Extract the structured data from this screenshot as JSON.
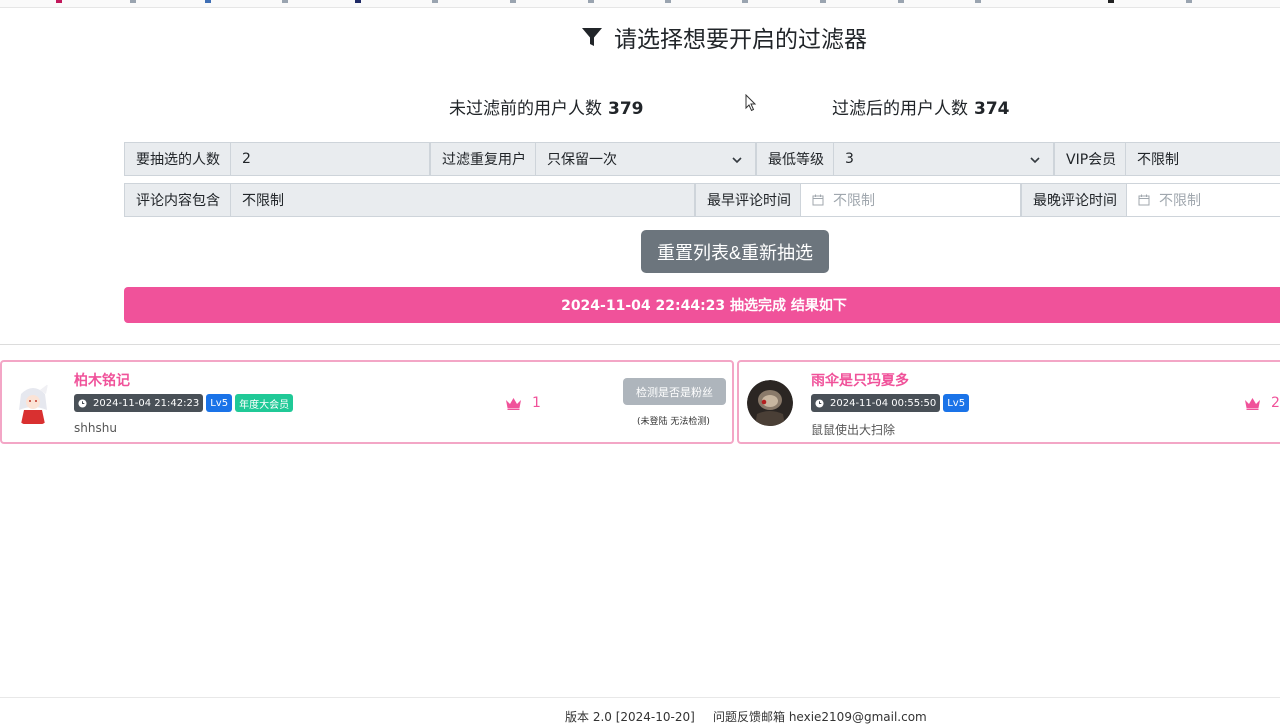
{
  "header": {
    "title": "请选择想要开启的过滤器",
    "before_label": "未过滤前的用户人数",
    "before_count": "379",
    "after_label": "过滤后的用户人数",
    "after_count": "374"
  },
  "filters": {
    "pick_count_label": "要抽选的人数",
    "pick_count_value": "2",
    "dedupe_label": "过滤重复用户",
    "dedupe_value": "只保留一次",
    "min_level_label": "最低等级",
    "min_level_value": "3",
    "vip_label": "VIP会员",
    "vip_value": "不限制",
    "comment_contains_label": "评论内容包含",
    "comment_contains_value": "不限制",
    "earliest_time_label": "最早评论时间",
    "earliest_time_placeholder": "不限制",
    "latest_time_label": "最晚评论时间",
    "latest_time_placeholder": "不限制"
  },
  "actions": {
    "reset_label": "重置列表&重新抽选"
  },
  "result_banner": "2024-11-04 22:44:23 抽选完成 结果如下",
  "winners": [
    {
      "name": "柏木铭记",
      "time": "2024-11-04 21:42:23",
      "level": "Lv5",
      "vip": "年度大会员",
      "comment": "shhshu",
      "rank": "1",
      "check_label": "检测是否是粉丝",
      "check_note": "(未登陆 无法检测)"
    },
    {
      "name": "雨伞是只玛夏多",
      "time": "2024-11-04 00:55:50",
      "level": "Lv5",
      "comment": "鼠鼠使出大扫除",
      "rank": "2"
    }
  ],
  "footer": {
    "version": "版本 2.0 [2024-10-20]",
    "feedback": "问题反馈邮箱 hexie2109@gmail.com"
  },
  "colors": {
    "accent": "#f0529a",
    "button_gray": "#6c757d",
    "level_badge": "#1a73e8",
    "vip_badge": "#20c997"
  },
  "icons": [
    "filter-icon",
    "chevron-down-icon",
    "calendar-icon",
    "clock-icon",
    "crown-icon"
  ]
}
